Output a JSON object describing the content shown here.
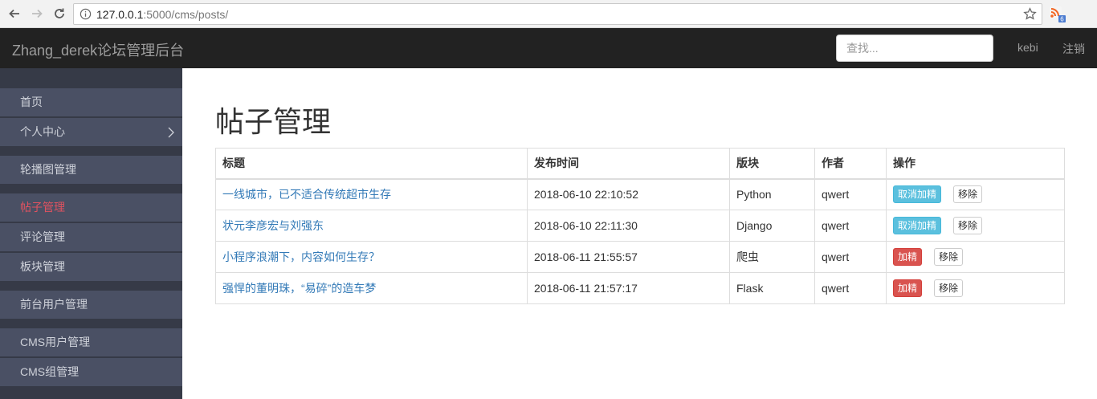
{
  "browser": {
    "url_host": "127.0.0.1",
    "url_path": ":5000/cms/posts/",
    "ext_badge": "6"
  },
  "navbar": {
    "brand": "Zhang_derek论坛管理后台",
    "search_placeholder": "查找...",
    "user": "kebi",
    "logout": "注销"
  },
  "sidebar": {
    "items": [
      {
        "label": "首页"
      },
      {
        "label": "个人中心"
      },
      {
        "label": "轮播图管理"
      },
      {
        "label": "帖子管理"
      },
      {
        "label": "评论管理"
      },
      {
        "label": "板块管理"
      },
      {
        "label": "前台用户管理"
      },
      {
        "label": "CMS用户管理"
      },
      {
        "label": "CMS组管理"
      }
    ]
  },
  "main": {
    "title": "帖子管理",
    "headers": [
      "标题",
      "发布时间",
      "版块",
      "作者",
      "操作"
    ],
    "rows": [
      {
        "title": "一线城市，已不适合传统超市生存",
        "time": "2018-06-10 22:10:52",
        "board": "Python",
        "author": "qwert",
        "highlight": "取消加精",
        "remove": "移除"
      },
      {
        "title": "状元李彦宏与刘强东",
        "time": "2018-06-10 22:11:30",
        "board": "Django",
        "author": "qwert",
        "highlight": "取消加精",
        "remove": "移除"
      },
      {
        "title": "小程序浪潮下，内容如何生存？",
        "time": "2018-06-11 21:55:57",
        "board": "爬虫",
        "author": "qwert",
        "highlight": "加精",
        "remove": "移除"
      },
      {
        "title": "强悍的董明珠，“易碎”的造车梦",
        "time": "2018-06-11 21:57:17",
        "board": "Flask",
        "author": "qwert",
        "highlight": "加精",
        "remove": "移除"
      }
    ]
  },
  "colors": {
    "navbar_bg": "#222222",
    "sidebar_bg": "#363a47",
    "sidebar_item_bg": "#4a5064",
    "sidebar_active": "#e05260",
    "link": "#337ab7",
    "btn_info": "#5bc0de",
    "btn_danger": "#d9534f"
  }
}
